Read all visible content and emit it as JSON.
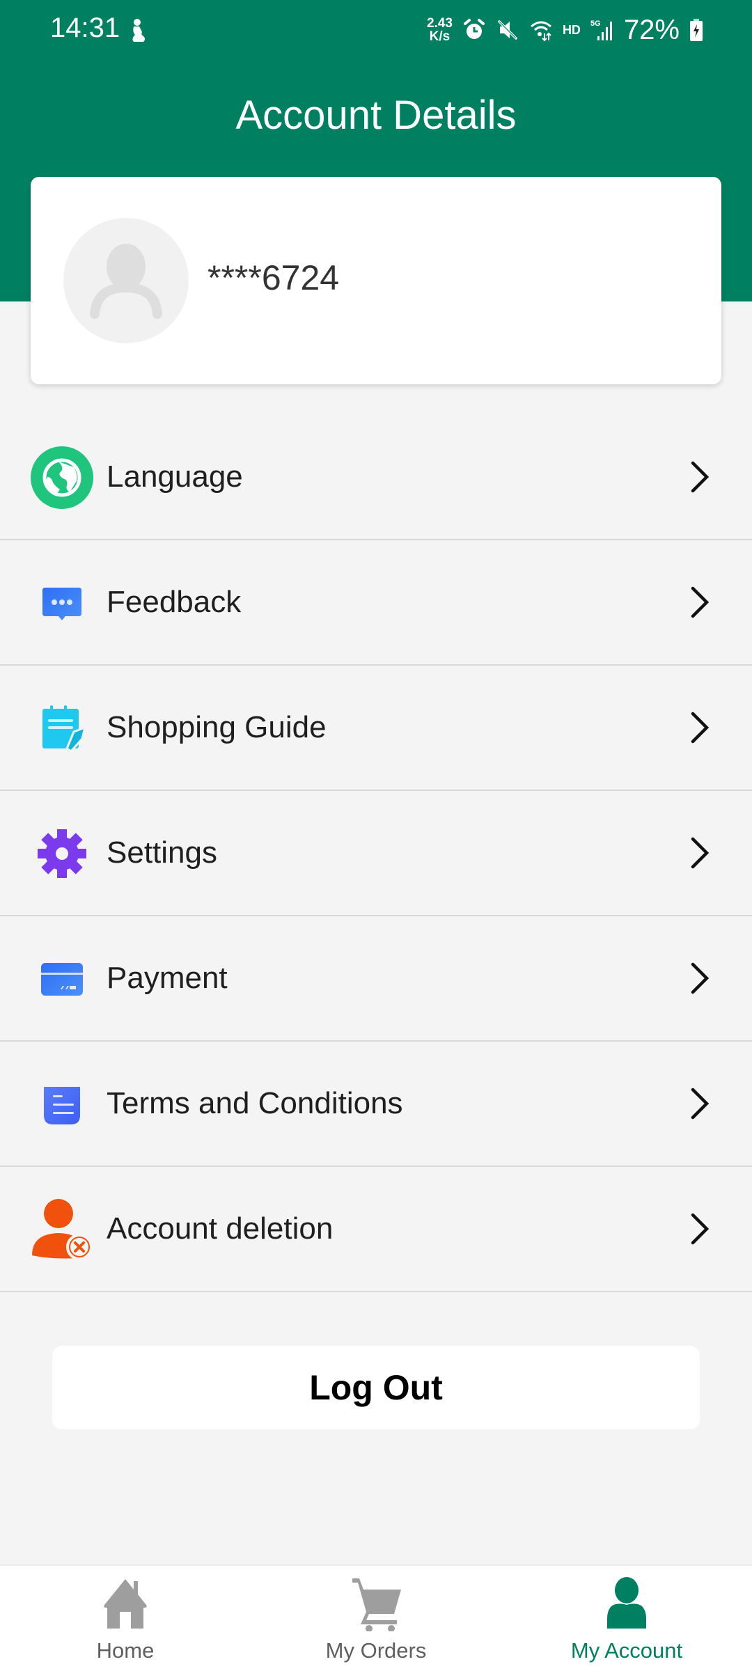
{
  "status_bar": {
    "time": "14:31",
    "net_speed_value": "2.43",
    "net_speed_unit": "K/s",
    "network_badge": "HD",
    "network_type": "5G",
    "battery_percent": "72%",
    "icons": [
      "person-status-icon",
      "alarm-icon",
      "mute-icon",
      "wifi-icon",
      "signal-icon",
      "battery-charging-icon"
    ]
  },
  "header": {
    "title": "Account Details"
  },
  "profile": {
    "account_id": "****6724",
    "avatar_icon": "default-avatar-icon"
  },
  "menu": {
    "items": [
      {
        "label": "Language",
        "icon": "globe-icon",
        "color": "#1fc47d"
      },
      {
        "label": "Feedback",
        "icon": "chat-bubble-icon",
        "color": "#3b82f6"
      },
      {
        "label": "Shopping Guide",
        "icon": "notepad-pen-icon",
        "color": "#1ec8ee"
      },
      {
        "label": "Settings",
        "icon": "gear-icon",
        "color": "#7c3aed"
      },
      {
        "label": "Payment",
        "icon": "credit-card-icon",
        "color": "#3d82f5"
      },
      {
        "label": "Terms and Conditions",
        "icon": "document-icon",
        "color": "#4f6ef7"
      },
      {
        "label": "Account deletion",
        "icon": "user-remove-icon",
        "color": "#f0520d"
      }
    ]
  },
  "logout": {
    "label": "Log Out"
  },
  "bottom_nav": {
    "items": [
      {
        "label": "Home",
        "icon": "home-icon",
        "active": false
      },
      {
        "label": "My Orders",
        "icon": "cart-icon",
        "active": false
      },
      {
        "label": "My Account",
        "icon": "user-icon",
        "active": true
      }
    ],
    "active_color": "#008061",
    "inactive_color": "#9e9e9e"
  },
  "theme": {
    "brand_green": "#008061",
    "background": "#f4f4f4"
  }
}
